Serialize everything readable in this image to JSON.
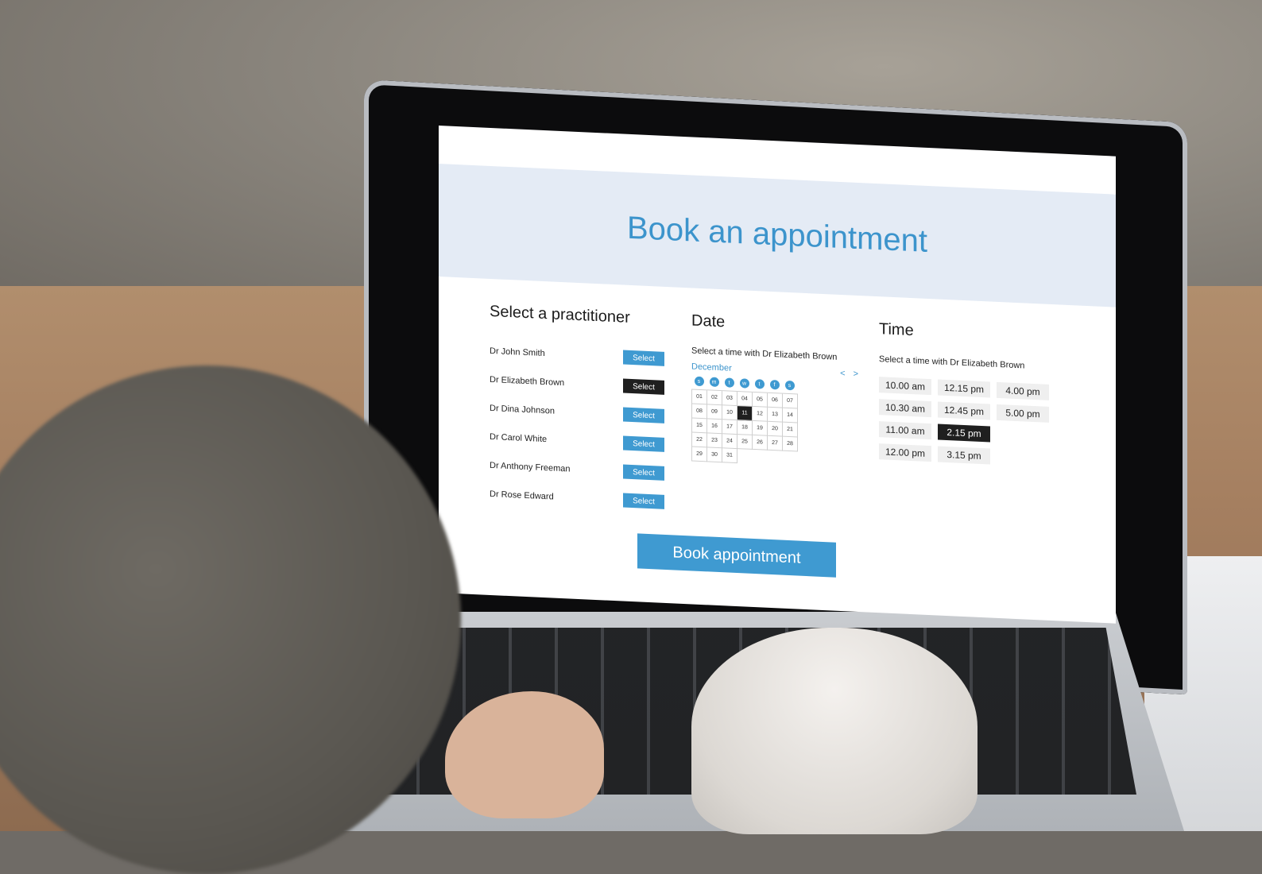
{
  "page": {
    "title": "Book an appointment"
  },
  "practitioners": {
    "heading": "Select a practitioner",
    "items": [
      {
        "name": "Dr John Smith",
        "button": "Select",
        "selected": false
      },
      {
        "name": "Dr Elizabeth Brown",
        "button": "Select",
        "selected": true
      },
      {
        "name": "Dr Dina Johnson",
        "button": "Select",
        "selected": false
      },
      {
        "name": "Dr Carol White",
        "button": "Select",
        "selected": false
      },
      {
        "name": "Dr Anthony Freeman",
        "button": "Select",
        "selected": false
      },
      {
        "name": "Dr Rose Edward",
        "button": "Select",
        "selected": false
      }
    ]
  },
  "date": {
    "heading": "Date",
    "subtitle": "Select a time with Dr Elizabeth Brown",
    "month": "December",
    "prev": "<",
    "next": ">",
    "weekdays": [
      "s",
      "m",
      "t",
      "w",
      "t",
      "f",
      "s"
    ],
    "days": [
      "01",
      "02",
      "03",
      "04",
      "05",
      "06",
      "07",
      "08",
      "09",
      "10",
      "11",
      "12",
      "13",
      "14",
      "15",
      "16",
      "17",
      "18",
      "19",
      "20",
      "21",
      "22",
      "23",
      "24",
      "25",
      "26",
      "27",
      "28",
      "29",
      "30",
      "31"
    ],
    "selected_day": "11"
  },
  "time": {
    "heading": "Time",
    "subtitle": "Select a time with Dr Elizabeth Brown",
    "slots": [
      {
        "label": "10.00 am",
        "selected": false
      },
      {
        "label": "12.15 pm",
        "selected": false
      },
      {
        "label": "4.00 pm",
        "selected": false
      },
      {
        "label": "10.30 am",
        "selected": false
      },
      {
        "label": "12.45 pm",
        "selected": false
      },
      {
        "label": "5.00 pm",
        "selected": false
      },
      {
        "label": "11.00 am",
        "selected": false
      },
      {
        "label": "2.15 pm",
        "selected": true
      },
      {
        "label": "",
        "selected": false
      },
      {
        "label": "12.00 pm",
        "selected": false
      },
      {
        "label": "3.15 pm",
        "selected": false
      },
      {
        "label": "",
        "selected": false
      }
    ]
  },
  "actions": {
    "book": "Book appointment"
  },
  "colors": {
    "accent": "#3f9ad1",
    "hero_bg": "#e4ebf5",
    "selected": "#1f1f1f"
  }
}
